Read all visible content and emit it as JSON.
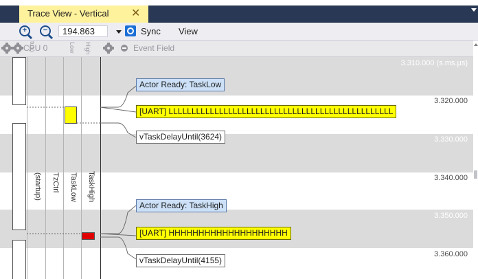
{
  "tab": {
    "title": "Trace View - Vertical",
    "close_glyph": "✕"
  },
  "toolbar": {
    "zoom_value": "194.863",
    "sync_label": "Sync",
    "view_label": "View",
    "icons": [
      "zoom-in-icon",
      "zoom-out-icon",
      "chevron-down-icon",
      "sync-icon"
    ]
  },
  "header": {
    "cpu_label": "CPU 0",
    "low_label": "Low",
    "high_label": "High",
    "startup_fragment": "tup)",
    "event_field": "Event Field"
  },
  "tracks": [
    "(startup)",
    "TzCtrl",
    "TaskLow",
    "TaskHigh"
  ],
  "timeline": [
    {
      "time": "3.310.000 (s.ms.µs)",
      "style": "light"
    },
    {
      "time": "3.320.000",
      "style": "dark"
    },
    {
      "time": "3.330.000",
      "style": "light"
    },
    {
      "time": "3.340.000",
      "style": "dark"
    },
    {
      "time": "3.350.000",
      "style": "light"
    },
    {
      "time": "3.360.000",
      "style": "dark"
    }
  ],
  "events": [
    {
      "text": "Actor Ready: TaskLow",
      "kind": "actor"
    },
    {
      "text": "[UART] LLLLLLLLLLLLLLLLLLLLLLLLLLLLLLLLLLLLLLLLLLLLLLLLL",
      "kind": "uart"
    },
    {
      "text": "vTaskDelayUntil(3624)",
      "kind": "call"
    },
    {
      "text": "Actor Ready: TaskHigh",
      "kind": "actor"
    },
    {
      "text": "[UART] HHHHHHHHHHHHHHHHHHHH",
      "kind": "uart"
    },
    {
      "text": "vTaskDelayUntil(4155)",
      "kind": "call"
    }
  ],
  "colors": {
    "tab_bg": "#fff29d",
    "title_bar": "#293955",
    "band": "#dbdbdb",
    "actor_event": "#cce0f7",
    "uart_event": "#ffff00",
    "tasklow_exec": "#ffff00",
    "taskhigh_exec": "#e00000"
  }
}
